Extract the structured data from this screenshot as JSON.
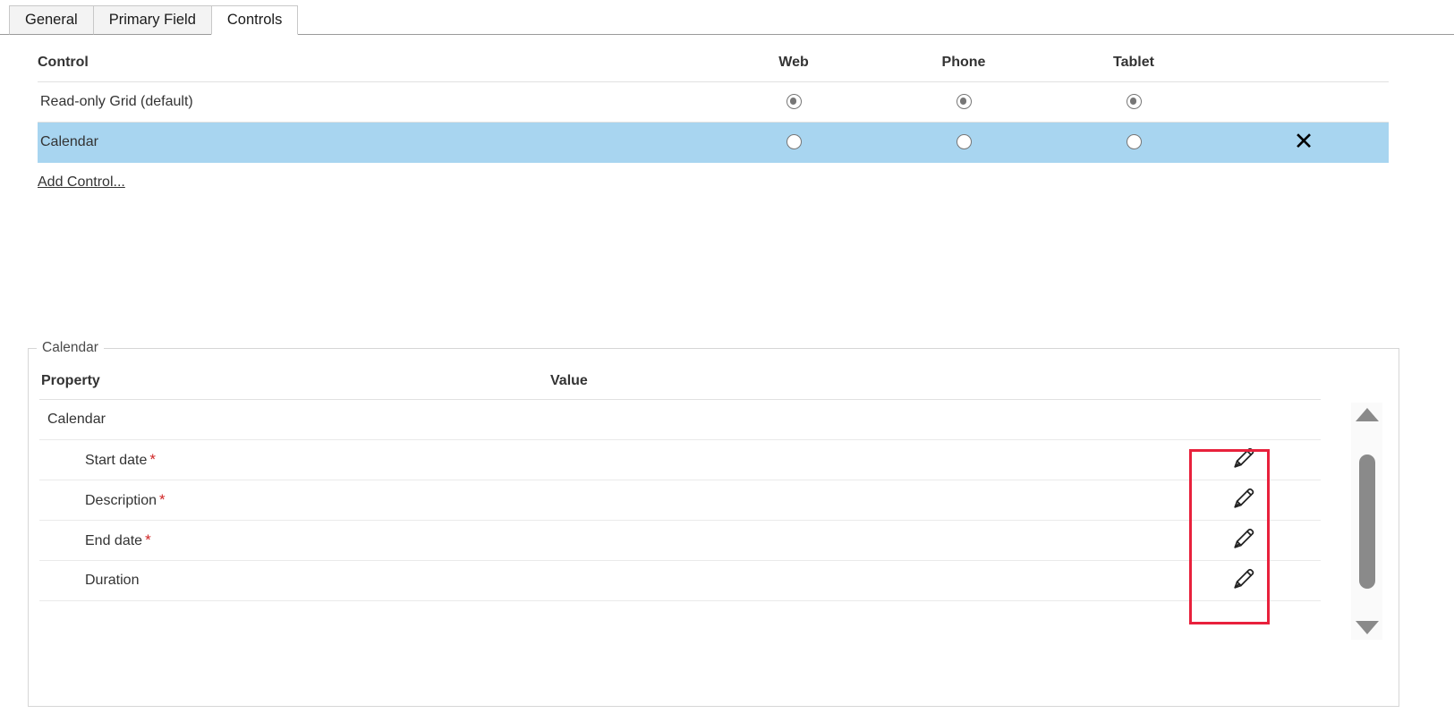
{
  "tabs": [
    {
      "label": "General",
      "active": false
    },
    {
      "label": "Primary Field",
      "active": false
    },
    {
      "label": "Controls",
      "active": true
    }
  ],
  "control_table": {
    "headers": {
      "control": "Control",
      "web": "Web",
      "phone": "Phone",
      "tablet": "Tablet"
    },
    "rows": [
      {
        "name": "Read-only Grid (default)",
        "web": "selected",
        "phone": "selected",
        "tablet": "selected",
        "removable": false,
        "highlighted": false
      },
      {
        "name": "Calendar",
        "web": "unselected",
        "phone": "unselected",
        "tablet": "unselected",
        "removable": true,
        "remove_icon": "close-x-icon",
        "highlighted": true
      }
    ],
    "add_control_label": "Add Control..."
  },
  "calendar_panel": {
    "legend": "Calendar",
    "headers": {
      "property": "Property",
      "value": "Value"
    },
    "rows": [
      {
        "name": "Calendar",
        "required": false,
        "indent": false,
        "value": "",
        "edit_icon": ""
      },
      {
        "name": "Start date",
        "required": true,
        "indent": true,
        "value": "",
        "edit_icon": "pencil-icon"
      },
      {
        "name": "Description",
        "required": true,
        "indent": true,
        "value": "",
        "edit_icon": "pencil-icon"
      },
      {
        "name": "End date",
        "required": true,
        "indent": true,
        "value": "",
        "edit_icon": "pencil-icon"
      },
      {
        "name": "Duration",
        "required": false,
        "indent": true,
        "value": "",
        "edit_icon": "pencil-icon"
      }
    ],
    "required_marker": "*",
    "scrollbar": {
      "up_icon": "triangle-up-icon",
      "down_icon": "triangle-down-icon"
    }
  },
  "annotation": {
    "type": "highlight-box",
    "color": "#e8213c"
  },
  "colors": {
    "selected_row": "#a8d5f0",
    "required": "#d02626",
    "annotation": "#e8213c",
    "scrollbar": "#8a8a8a"
  }
}
